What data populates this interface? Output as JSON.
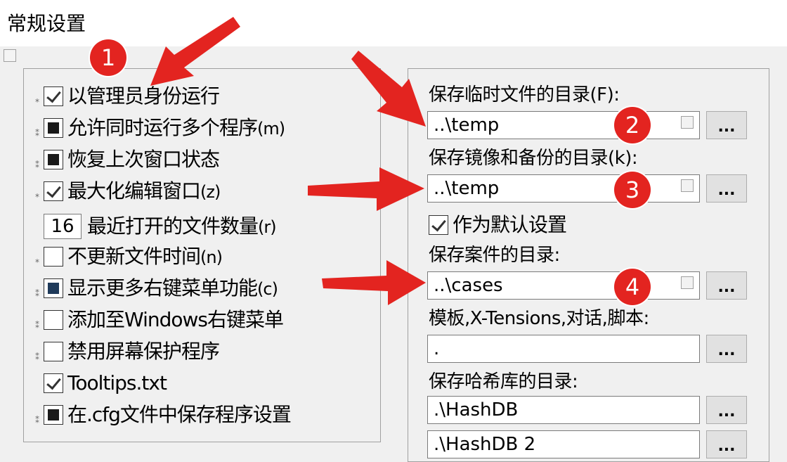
{
  "window": {
    "title": "常规设置"
  },
  "left_options": [
    {
      "marker": "*",
      "state": "checked",
      "label": "以管理员身份运行",
      "suffix": ""
    },
    {
      "marker": "⁑",
      "state": "indeterminate",
      "label": "允许同时运行多个程序",
      "suffix": "(m)"
    },
    {
      "marker": "⁑",
      "state": "indeterminate",
      "label": "恢复上次窗口状态",
      "suffix": ""
    },
    {
      "marker": "*",
      "state": "checked",
      "label": "最大化编辑窗口",
      "suffix": "(z)"
    },
    {
      "marker": "",
      "state": "number",
      "value": "16",
      "label": "最近打开的文件数量",
      "suffix": "(r)"
    },
    {
      "marker": "*",
      "state": "unchecked",
      "label": "不更新文件时间",
      "suffix": "(n)"
    },
    {
      "marker": "⁑",
      "state": "indeterminate-blue",
      "label": "显示更多右键菜单功能",
      "suffix": "(c)"
    },
    {
      "marker": "⁑",
      "state": "unchecked",
      "label": "添加至Windows右键菜单",
      "suffix": ""
    },
    {
      "marker": "⁑",
      "state": "unchecked",
      "label": "禁用屏幕保护程序",
      "suffix": ""
    },
    {
      "marker": "",
      "state": "checked",
      "label": "Tooltips.txt",
      "suffix": ""
    },
    {
      "marker": "⁑",
      "state": "indeterminate",
      "label": "在.cfg文件中保存程序设置",
      "suffix": ""
    }
  ],
  "right_fields": {
    "temp_label": "保存临时文件的目录(F):",
    "temp_value": "..\\temp",
    "mirror_label": "保存镜像和备份的目录(k):",
    "mirror_value": "..\\temp",
    "default_label": "作为默认设置",
    "cases_label": "保存案件的目录:",
    "cases_value": "..\\cases",
    "templates_label": "模板,X-Tensions,对话,脚本:",
    "templates_value": ".",
    "hashdb_label": "保存哈希库的目录:",
    "hashdb_value": ".\\HashDB",
    "hashdb2_value": ".\\HashDB 2",
    "browse_label": "..."
  },
  "annotations": {
    "badge1": "1",
    "badge2": "2",
    "badge3": "3",
    "badge4": "4",
    "color": "#e32420"
  }
}
